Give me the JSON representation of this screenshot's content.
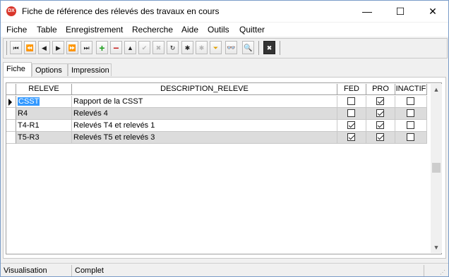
{
  "window": {
    "title": "Fiche de référence des rélevés des travaux en cours",
    "app_icon_text": "DX",
    "controls": {
      "minimize": "—",
      "maximize": "☐",
      "close": "✕"
    }
  },
  "menu": [
    "Fiche",
    "Table",
    "Enregistrement",
    "Recherche",
    "Aide",
    "Outils",
    "Quitter"
  ],
  "toolbar": {
    "buttons": [
      {
        "name": "first-record",
        "glyph": "⏮",
        "enabled": true
      },
      {
        "name": "prev-page",
        "glyph": "⏪",
        "enabled": true
      },
      {
        "name": "prev-record",
        "glyph": "◀",
        "enabled": true
      },
      {
        "name": "next-record",
        "glyph": "▶",
        "enabled": true
      },
      {
        "name": "next-page",
        "glyph": "⏩",
        "enabled": true
      },
      {
        "name": "last-record",
        "glyph": "⏭",
        "enabled": true
      },
      {
        "name": "add-record",
        "glyph": "+",
        "enabled": true,
        "color": "#1e9e1e"
      },
      {
        "name": "delete-record",
        "glyph": "−",
        "enabled": true,
        "color": "#c81e1e"
      },
      {
        "name": "edit-record",
        "glyph": "▲",
        "enabled": true
      },
      {
        "name": "post-edit",
        "glyph": "✔",
        "enabled": false
      },
      {
        "name": "cancel-edit",
        "glyph": "✖",
        "enabled": false
      },
      {
        "name": "refresh",
        "glyph": "↻",
        "enabled": true
      },
      {
        "name": "filter-star",
        "glyph": "✱",
        "enabled": true
      },
      {
        "name": "filter-clear",
        "glyph": "✱",
        "enabled": false
      },
      {
        "name": "filter-funnel",
        "glyph": "⏷",
        "enabled": true,
        "color": "#e0a000"
      },
      {
        "name": "binoculars",
        "glyph": "👓",
        "enabled": true
      },
      {
        "name": "search",
        "glyph": "🔍",
        "enabled": true
      },
      {
        "name": "close-form",
        "glyph": "✖",
        "enabled": true
      }
    ]
  },
  "tabs": [
    "Fiche",
    "Options",
    "Impression"
  ],
  "grid": {
    "columns": [
      "RELEVE",
      "DESCRIPTION_RELEVE",
      "FED",
      "PRO",
      "INACTIF"
    ],
    "rows": [
      {
        "releve": "CSST",
        "description": "Rapport de la CSST",
        "fed": false,
        "pro": true,
        "inactif": false,
        "current": true
      },
      {
        "releve": "R4",
        "description": "Relevés 4",
        "fed": false,
        "pro": true,
        "inactif": false,
        "current": false
      },
      {
        "releve": "T4-R1",
        "description": "Relevés T4 et relevés 1",
        "fed": true,
        "pro": true,
        "inactif": false,
        "current": false
      },
      {
        "releve": "T5-R3",
        "description": "Relevés T5 et relevés 3",
        "fed": true,
        "pro": true,
        "inactif": false,
        "current": false
      }
    ],
    "scroll": {
      "up": "▲",
      "down": "▼"
    }
  },
  "status": {
    "mode": "Visualisation",
    "state": "Complet"
  }
}
